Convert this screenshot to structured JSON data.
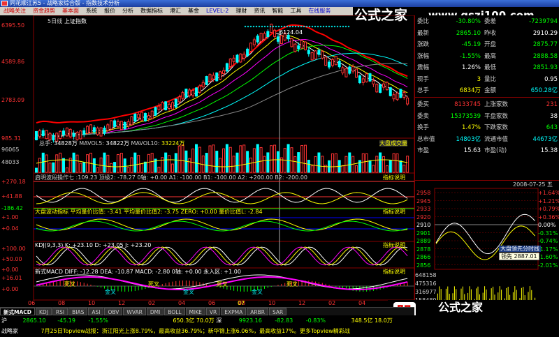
{
  "window": {
    "title": "同花顺江苏5 - 战略家综合版 - 指数技术分析"
  },
  "menu": {
    "items": [
      "战略关注",
      "资金趋势",
      "基本面",
      "系统",
      "报价",
      "分析",
      "数据指标",
      "港汇",
      "基金",
      "LEVEL-2",
      "理财",
      "资讯",
      "智能",
      "工具",
      "在线服务"
    ]
  },
  "watermark": {
    "brand": "公式之家",
    "url": "www.gszj100.com",
    "badge": "股"
  },
  "chart": {
    "period_label": "5日线",
    "index_name": "上证指数",
    "price_axis": [
      "6395.50",
      "4589.86",
      "2783.09",
      "985.31"
    ],
    "peak_label": "6124.04",
    "volume_header": {
      "name": "总手",
      "value": "34828万",
      "mavol5_label": "MAVOL5",
      "mavol5": "34822万",
      "mavol10_label": "MAVOL10",
      "mavol10": "33224万",
      "tag": "大盘成交量"
    },
    "volume_axis": [
      "96065",
      "48033"
    ],
    "ind1": {
      "text": "启明波段操作七 :109.23 顶级2: -78.27 0轴: +0.00 A1: -100.00 B1: -100.00 A2: +200.00 B2: -200.00",
      "axis": [
        "+270.18",
        "+41.88",
        "-186.42"
      ],
      "tag": "指标说明"
    },
    "ind2": {
      "text": "大盘波动指标 平均量价比值: -3.41 平均量价比值2: -3.75 ZERO: +0.00 量价比值L: -2.84",
      "axis": [
        "+1.00",
        "+0.04"
      ],
      "tag": "指标说明"
    },
    "kdj": {
      "text": "KDJ(9,3,3) K: +23.10 D: +23.05 J: +23.20",
      "axis": [
        "+100.00",
        "+50.00",
        "+0.00"
      ],
      "tag": "指标说明"
    },
    "macd": {
      "text": "新式MACD DIFF: -12.28 DEA: -10.87 MACD: -2.80 0轴: +0.00 永入区: +1.00",
      "axis": [
        "+16.01",
        "+0.00"
      ],
      "tag": "指标说明"
    },
    "signal_labels": [
      "死叉",
      "金叉",
      "死叉",
      "金叉",
      "死叉",
      "金叉",
      "死叉"
    ],
    "date_axis": [
      "06",
      "08",
      "10",
      "12",
      "02",
      "04",
      "06",
      "08",
      "10",
      "12",
      "02",
      "04",
      "06"
    ],
    "year_axis": [
      "07"
    ]
  },
  "quote": {
    "rows": [
      {
        "l1": "委比",
        "v1": "-30.80%",
        "l2": "委差",
        "v2": "-7239794",
        "c1": "#0f0",
        "c2": "#0f0"
      },
      {
        "l1": "最新",
        "v1": "2865.10",
        "l2": "昨收",
        "v2": "2910.29",
        "c1": "#0f0",
        "c2": "#fff"
      },
      {
        "l1": "涨跌",
        "v1": "-45.19",
        "l2": "开盘",
        "v2": "2875.77",
        "c1": "#0f0",
        "c2": "#0f0"
      },
      {
        "l1": "涨幅",
        "v1": "-1.55%",
        "l2": "最高",
        "v2": "2888.58",
        "c1": "#0f0",
        "c2": "#0f0"
      },
      {
        "l1": "震幅",
        "v1": "1.26%",
        "l2": "最低",
        "v2": "2851.93",
        "c1": "#fff",
        "c2": "#0f0"
      },
      {
        "l1": "现手",
        "v1": "3",
        "l2": "量比",
        "v2": "0.95",
        "c1": "#ff0",
        "c2": "#fff"
      },
      {
        "l1": "总手",
        "v1": "6834万",
        "l2": "金额",
        "v2": "650.28亿",
        "c1": "#ff0",
        "c2": "#0ff"
      }
    ],
    "rows2": [
      {
        "l1": "委买",
        "v1": "8133745",
        "l2": "上涨家数",
        "v2": "231",
        "c1": "#f33",
        "c2": "#f33"
      },
      {
        "l1": "委卖",
        "v1": "15373539",
        "l2": "平盘家数",
        "v2": "38",
        "c1": "#0f0",
        "c2": "#fff"
      },
      {
        "l1": "换手",
        "v1": "1.47%",
        "l2": "下跌家数",
        "v2": "643",
        "c1": "#ff0",
        "c2": "#0f0"
      },
      {
        "l1": "总市值",
        "v1": "14803亿",
        "l2": "流通市值",
        "v2": "44673亿",
        "c1": "#0ff",
        "c2": "#0ff"
      },
      {
        "l1": "市盈",
        "v1": "15.63",
        "l2": "市盈(动)",
        "v2": "15.38",
        "c1": "#fff",
        "c2": "#fff"
      }
    ]
  },
  "mini": {
    "date": "2008-07-25",
    "weekday": "五",
    "prices": [
      "2958",
      "2945",
      "2933",
      "2920",
      "2910",
      "2901",
      "2889",
      "2878",
      "2866",
      "2856"
    ],
    "pcts": [
      "+1.64%",
      "+1.21%",
      "+0.79%",
      "+0.36%",
      "0.00%",
      "-0.31%",
      "-0.74%",
      "-1.17%",
      "-1.60%",
      "-2.01%"
    ],
    "vols": [
      "648158",
      "475316",
      "316977",
      "158489"
    ],
    "tooltip_title": "大盘领先分时线",
    "tooltip_label": "领先",
    "tooltip_value": "2887.01"
  },
  "tabs": [
    "新式MACD",
    "KDJ",
    "RSI",
    "BIAS",
    "ASI",
    "OBV",
    "WVAR",
    "DMI",
    "BOLL",
    "MIKE",
    "VR",
    "EXPMA",
    "ARBR",
    "SAR"
  ],
  "status": {
    "market": "沪",
    "price": "2865.10",
    "change": "-45.19",
    "pct": "-1.55%",
    "amount": "650.3亿",
    "vol": "70.0万",
    "market2": "深",
    "price2": "9923.16",
    "change2": "-82.83",
    "pct2": "-0.83%",
    "amount2": "348.5亿",
    "vol2": "18.0万",
    "app": "战略家",
    "ticker": "7月25日Topview战报：浙江阳光上涨8.79%，最高收益36.79%；新华锦上涨6.06%，最高收益17%。更多Topview精彩战"
  }
}
